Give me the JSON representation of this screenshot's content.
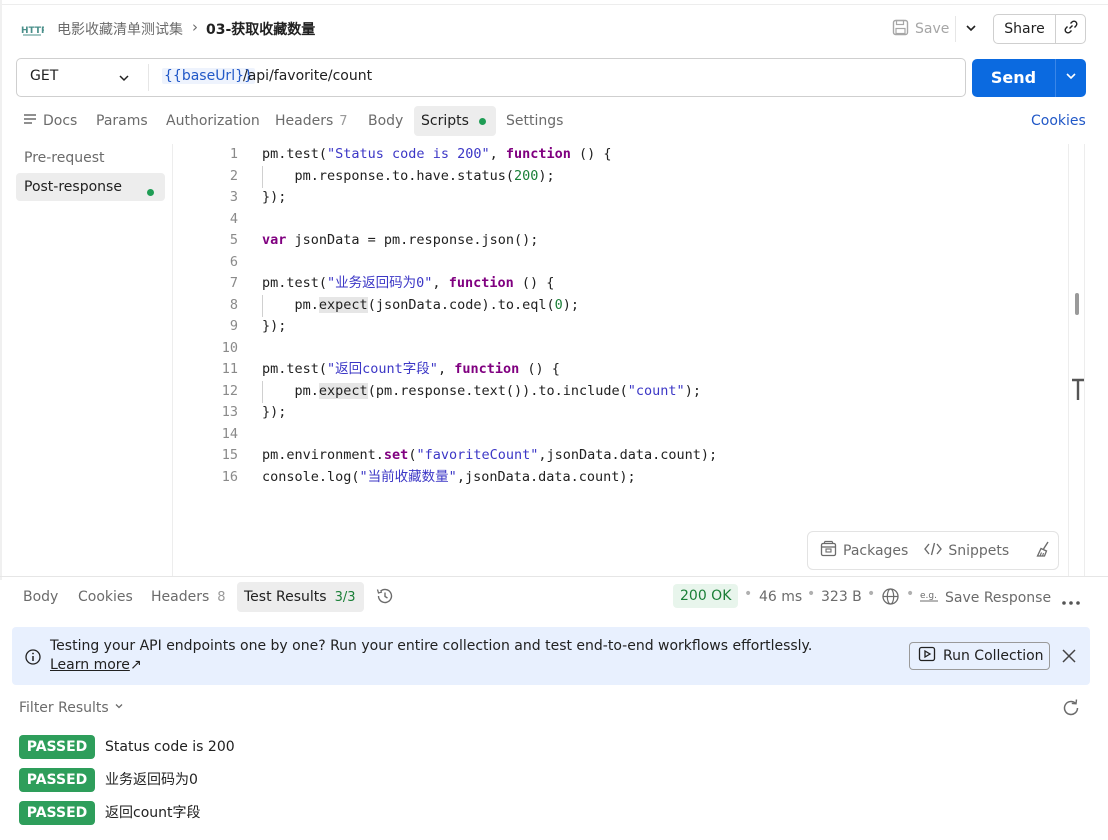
{
  "header": {
    "breadcrumb_parent": "电影收藏清单测试集",
    "breadcrumb_separator": "›",
    "request_name": "03-获取收藏数量",
    "save_label": "Save",
    "share_label": "Share"
  },
  "url_bar": {
    "method": "GET",
    "base_var": "{{baseUrl}}",
    "path": "/api/favorite/count",
    "send_label": "Send"
  },
  "request_tabs": {
    "docs": "Docs",
    "params": "Params",
    "authorization": "Authorization",
    "headers": "Headers",
    "headers_count": "7",
    "body": "Body",
    "scripts": "Scripts",
    "settings": "Settings",
    "cookies": "Cookies"
  },
  "script_sidebar": {
    "pre_request": "Pre-request",
    "post_response": "Post-response"
  },
  "code_lines": [
    "1",
    "2",
    "3",
    "4",
    "5",
    "6",
    "7",
    "8",
    "9",
    "10",
    "11",
    "12",
    "13",
    "14",
    "15",
    "16"
  ],
  "code_strings": {
    "s1": "\"Status code is 200\"",
    "s7": "\"业务返回码为0\"",
    "s11": "\"返回count字段\"",
    "s12": "\"count\"",
    "s15": "\"favoriteCount\"",
    "s16": "\"当前收藏数量\""
  },
  "editor_tools": {
    "packages": "Packages",
    "snippets": "Snippets"
  },
  "response_tabs": {
    "body": "Body",
    "cookies": "Cookies",
    "headers": "Headers",
    "headers_count": "8",
    "test_results": "Test Results",
    "test_results_count": "3/3"
  },
  "response_meta": {
    "status": "200 OK",
    "time": "46 ms",
    "size": "323 B",
    "save_response": "Save Response"
  },
  "banner": {
    "text": "Testing your API endpoints one by one? Run your entire collection and test end-to-end workflows effortlessly.",
    "link": "Learn more",
    "link_arrow": "↗",
    "button": "Run Collection"
  },
  "filter_label": "Filter Results",
  "test_results": [
    {
      "status": "PASSED",
      "name": "Status code is 200"
    },
    {
      "status": "PASSED",
      "name": "业务返回码为0"
    },
    {
      "status": "PASSED",
      "name": "返回count字段"
    }
  ],
  "colors": {
    "accent": "#0b6ae0",
    "passed": "#2e9e5b",
    "ok_text": "#1a7f37",
    "banner_bg": "#e8f0fe"
  }
}
